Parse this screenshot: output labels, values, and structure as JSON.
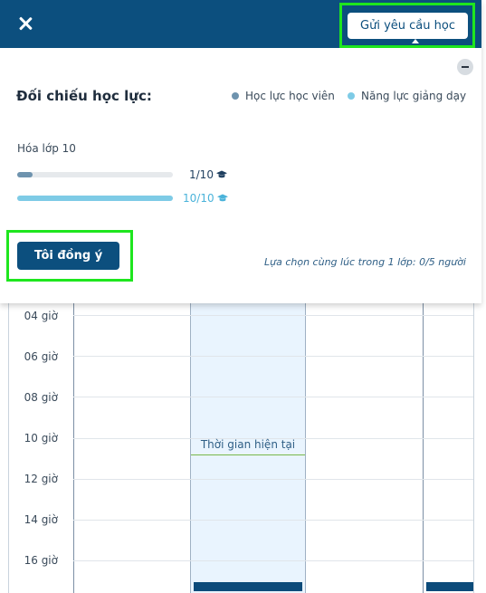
{
  "modal": {
    "send_request_label": "Gửi yêu cầu học",
    "title": "Đối chiếu học lực:",
    "legend": [
      {
        "label": "Học lực học viên",
        "color": "#6e93ae"
      },
      {
        "label": "Năng lực giảng dạy",
        "color": "#7ecbe6"
      }
    ],
    "subject": "Hóa lớp 10",
    "bars": [
      {
        "value_label": "1/10",
        "fraction": 0.1,
        "color": "#6e93ae",
        "text_color": "#1f3f5f",
        "icon": "graduation-cap-icon"
      },
      {
        "value_label": "10/10",
        "fraction": 1.0,
        "color": "#7ecbe6",
        "text_color": "#4ab3da",
        "icon": "graduation-cap-icon"
      }
    ],
    "agree_label": "Tôi đồng ý",
    "note": "Lựa chọn cùng lúc trong 1 lớp: 0/5 người"
  },
  "calendar": {
    "hours": [
      "04 giờ",
      "06 giờ",
      "08 giờ",
      "10 giờ",
      "12 giờ",
      "14 giờ",
      "16 giờ"
    ],
    "now_label": "Thời gian hiện tại"
  },
  "colors": {
    "header": "#0c4f7e",
    "highlight": "#1ee61e",
    "today": "#e9f4fe"
  }
}
